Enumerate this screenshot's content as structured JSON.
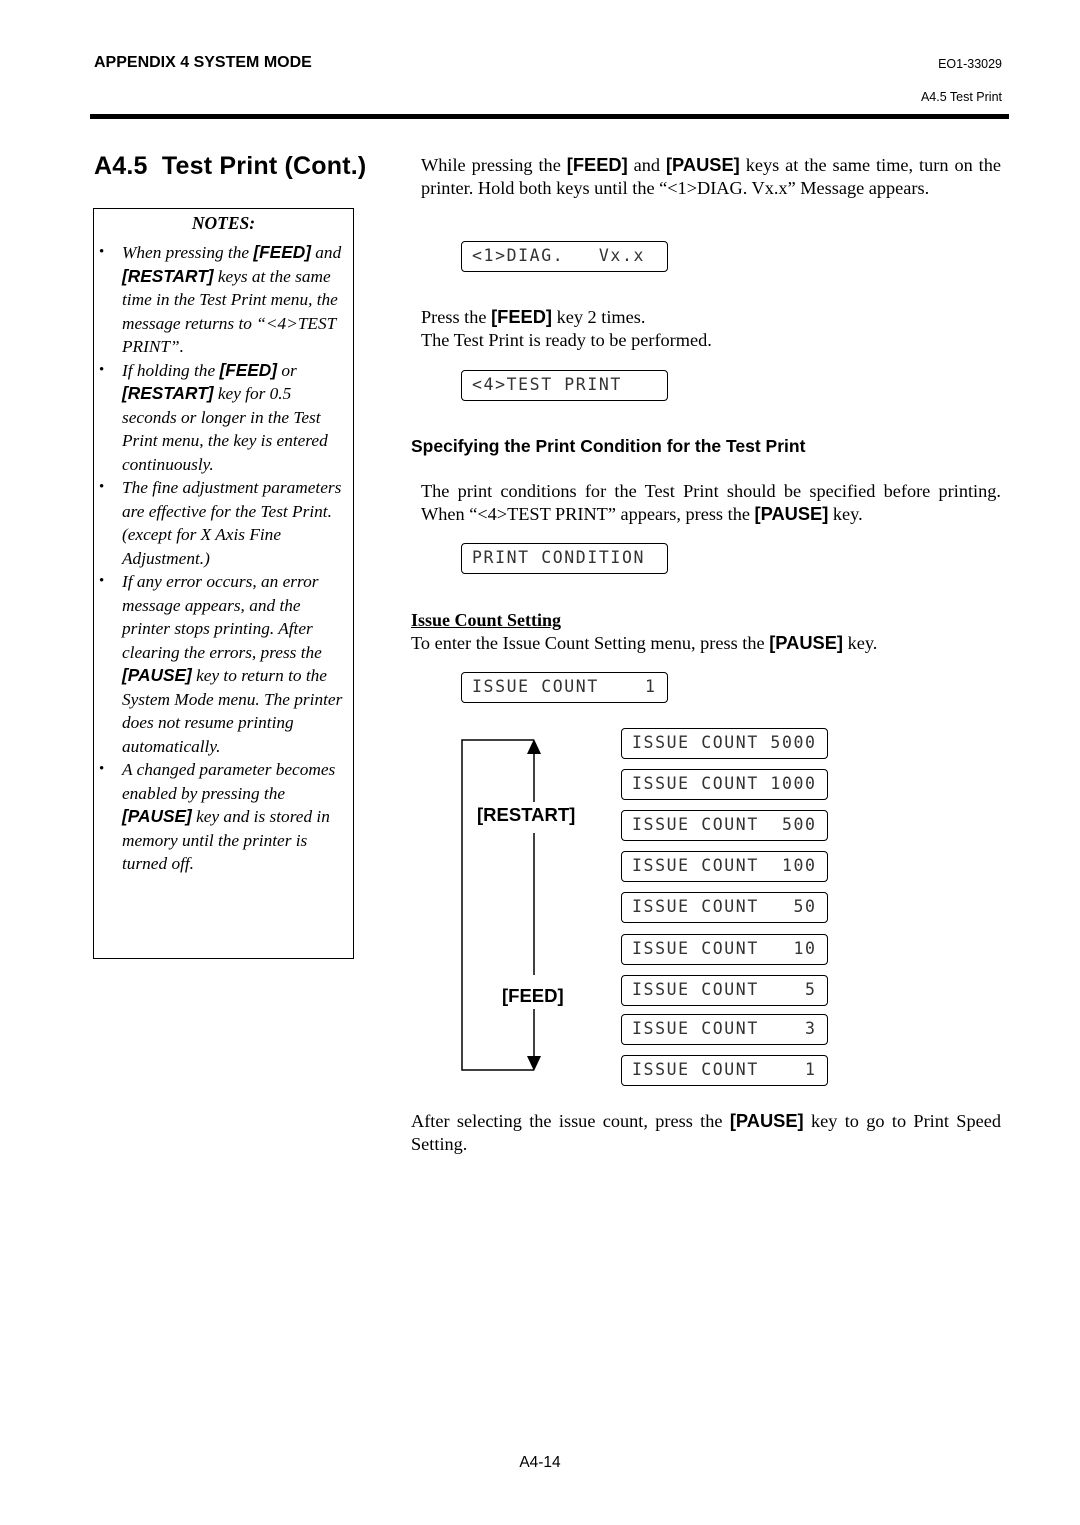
{
  "header": {
    "section": "APPENDIX 4 SYSTEM MODE",
    "doc_id": "EO1-33029",
    "subsection": "A4.5 Test Print"
  },
  "title": "A4.5  Test Print (Cont.)",
  "notes": {
    "title": "NOTES:",
    "items": [
      {
        "parts": [
          "When pressing the ",
          "[FEED]",
          " and ",
          "[RESTART]",
          " keys at the same time in the Test Print menu, the message returns to “<4>TEST PRINT”."
        ]
      },
      {
        "parts": [
          "If holding the ",
          "[FEED]",
          " or ",
          "[RESTART]",
          " key for 0.5 seconds or longer in the Test Print menu, the key is entered continuously."
        ]
      },
      {
        "parts": [
          "The fine adjustment parameters are effective for the Test Print. (except for X Axis Fine Adjustment.)"
        ]
      },
      {
        "parts": [
          "If any error occurs, an error message appears, and the printer stops printing. After clearing the errors, press the ",
          "[PAUSE]",
          " key to return to the System Mode menu. The printer does not resume printing automatically."
        ]
      },
      {
        "parts": [
          "A changed parameter becomes enabled by pressing the ",
          "[PAUSE]",
          " key and is stored in memory until the printer is turned off."
        ]
      }
    ]
  },
  "main": {
    "intro": {
      "t1": "While pressing the ",
      "k1": "[FEED]",
      "t2": " and ",
      "k2": "[PAUSE]",
      "t3": " keys at the same time, turn on the printer.  Hold both keys until the “<1>DIAG. Vx.x” Message appears."
    },
    "lcd_diag": "<1>DIAG.   Vx.x",
    "press_feed": {
      "t1": "Press the ",
      "k1": "[FEED]",
      "t2": " key 2 times.",
      "line2": "The Test Print is ready to be performed."
    },
    "lcd_test_print": "<4>TEST PRINT",
    "print_condition_heading": "Specifying the Print Condition for the Test Print",
    "print_condition_text": {
      "t1": "The print conditions for the Test Print should be specified before printing.  When “<4>TEST PRINT” appears, press the ",
      "k1": "[PAUSE]",
      "t2": " key."
    },
    "lcd_print_condition": "PRINT CONDITION",
    "issue_count_heading": "Issue Count Setting",
    "issue_count_text": {
      "t1": "To enter the Issue Count Setting menu, press the ",
      "k1": "[PAUSE]",
      "t2": " key."
    },
    "lcd_issue_count_default": "ISSUE COUNT    1",
    "flow": {
      "up_key": "[RESTART]",
      "down_key": "[FEED]",
      "options": [
        "ISSUE COUNT 5000",
        "ISSUE COUNT 1000",
        "ISSUE COUNT  500",
        "ISSUE COUNT  100",
        "ISSUE COUNT   50",
        "ISSUE COUNT   10",
        "ISSUE COUNT    5",
        "ISSUE COUNT    3",
        "ISSUE COUNT    1"
      ]
    },
    "after_text": {
      "t1": "After selecting the issue count, press the ",
      "k1": "[PAUSE]",
      "t2": " key to go to Print Speed Setting."
    }
  },
  "footer": {
    "page_number": "A4-14"
  }
}
